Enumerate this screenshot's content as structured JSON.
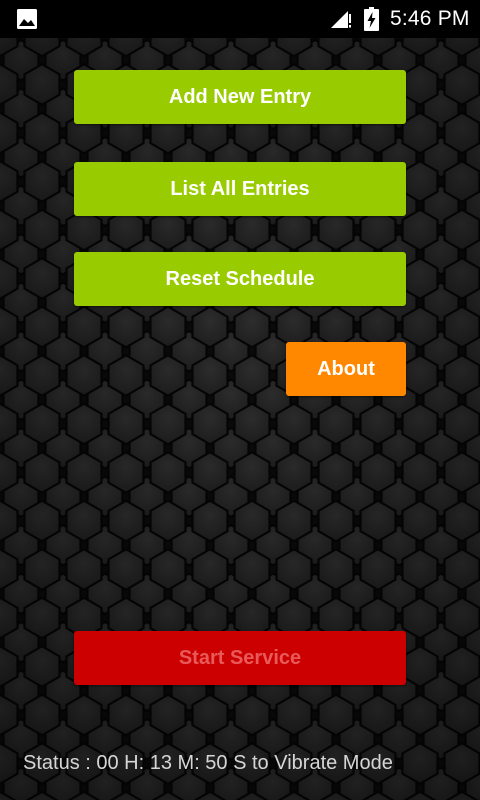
{
  "status_bar": {
    "time": "5:46 PM",
    "icons": [
      "gallery-icon",
      "signal-icon",
      "battery-charging-icon"
    ]
  },
  "menu": {
    "add_new_entry": "Add New Entry",
    "list_all_entries": "List All Entries",
    "reset_schedule": "Reset Schedule",
    "about": "About"
  },
  "service": {
    "start_label": "Start Service"
  },
  "status": {
    "text": "Status :  00 H: 13 M: 50 S to Vibrate Mode"
  },
  "colors": {
    "primary_button": "#99cc00",
    "about_button": "#ff8800",
    "start_button": "#cc0000",
    "start_button_text": "#e85a5a",
    "background": "#141414",
    "status_bar": "#000000"
  }
}
